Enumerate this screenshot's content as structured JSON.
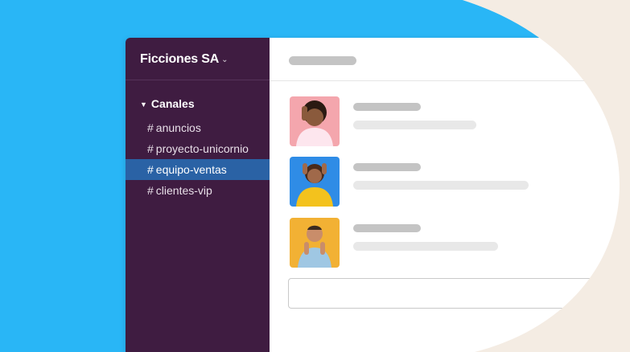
{
  "workspace": {
    "name": "Ficciones SA",
    "chevron": "⌄"
  },
  "sidebar": {
    "section_title": "Canales",
    "channels": [
      {
        "hash": "#",
        "name": "anuncios"
      },
      {
        "hash": "#",
        "name": "proyecto-unicornio"
      },
      {
        "hash": "#",
        "name": "equipo-ventas"
      },
      {
        "hash": "#",
        "name": "clientes-vip"
      }
    ],
    "active_channel": "equipo-ventas"
  },
  "colors": {
    "background": "#f4ece3",
    "blue_shape": "#29b6f6",
    "sidebar": "#3f1c41",
    "active_item": "#2a62a5",
    "avatar_1": "#f4a6ad",
    "avatar_2": "#2f8ce6",
    "avatar_3": "#f2b134"
  },
  "icons": {
    "section_toggle": "triangle-down-icon",
    "workspace_menu": "chevron-down-icon"
  }
}
